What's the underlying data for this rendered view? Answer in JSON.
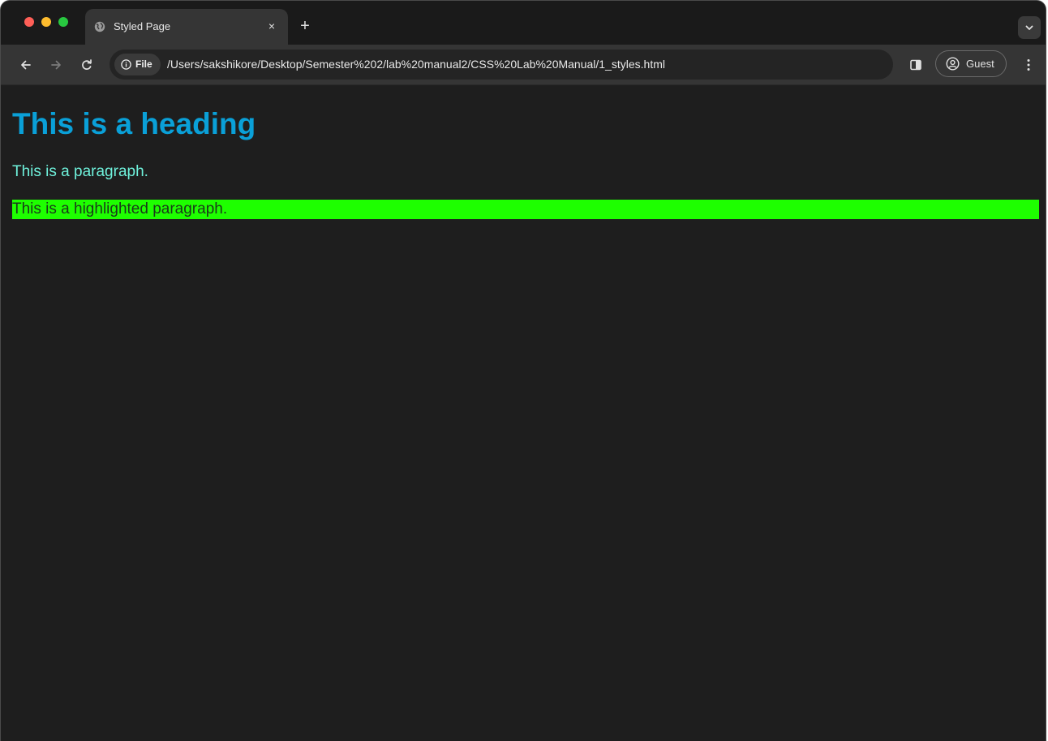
{
  "browser": {
    "tab": {
      "title": "Styled Page",
      "close_glyph": "×",
      "icon": "globe-icon"
    },
    "new_tab_glyph": "+",
    "address_bar": {
      "chip_label": "File",
      "url": "/Users/sakshikore/Desktop/Semester%202/lab%20manual2/CSS%20Lab%20Manual/1_styles.html"
    },
    "profile": {
      "label": "Guest"
    },
    "colors": {
      "traffic_close": "#ff5f57",
      "traffic_minimize": "#febc2e",
      "traffic_maximize": "#28c840"
    }
  },
  "page": {
    "heading": "This is a heading",
    "paragraph": "This is a paragraph.",
    "highlighted_paragraph": "This is a highlighted paragraph.",
    "colors": {
      "background": "#1e1e1e",
      "heading": "#0aa0d8",
      "paragraph": "#6ff2dc",
      "highlight_background": "#1eff00"
    }
  }
}
